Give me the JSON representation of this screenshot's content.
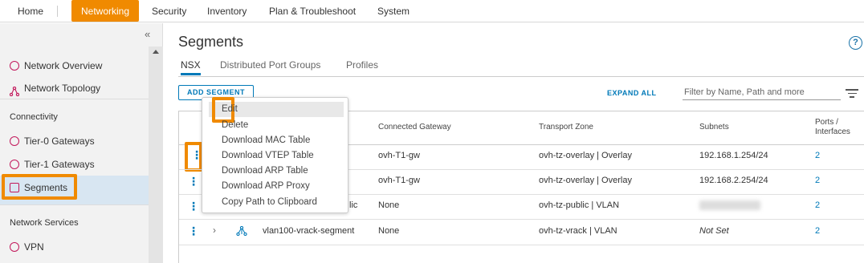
{
  "topnav": {
    "items": [
      "Home",
      "Networking",
      "Security",
      "Inventory",
      "Plan & Troubleshoot",
      "System"
    ],
    "active": "Networking"
  },
  "sidebar": {
    "items": [
      {
        "label": "Network Overview"
      },
      {
        "label": "Network Topology"
      }
    ],
    "connectivity_heading": "Connectivity",
    "connectivity": [
      {
        "label": "Tier-0 Gateways"
      },
      {
        "label": "Tier-1 Gateways"
      },
      {
        "label": "Segments"
      }
    ],
    "network_services_heading": "Network Services",
    "services": [
      {
        "label": "VPN"
      }
    ],
    "collapse_glyph": "«"
  },
  "main": {
    "title": "Segments",
    "help": "?",
    "tabs": [
      "NSX",
      "Distributed Port Groups",
      "Profiles"
    ],
    "add_button": "ADD SEGMENT",
    "expand_all": "EXPAND ALL",
    "filter_placeholder": "Filter by Name, Path and more"
  },
  "table": {
    "headers": {
      "connected_gateway": "Connected Gateway",
      "transport_zone": "Transport Zone",
      "subnets": "Subnets",
      "ports": "Ports / Interfaces"
    },
    "rows": [
      {
        "name": "",
        "gateway": "ovh-T1-gw",
        "zone": "ovh-tz-overlay | Overlay",
        "subnet": "192.168.1.254/24",
        "ports": "2"
      },
      {
        "name": "",
        "gateway": "ovh-T1-gw",
        "zone": "ovh-tz-overlay | Overlay",
        "subnet": "192.168.2.254/24",
        "ports": "2"
      },
      {
        "name": "lic",
        "gateway": "None",
        "zone": "ovh-tz-public | VLAN",
        "subnet": "",
        "ports": "2"
      },
      {
        "name": "vlan100-vrack-segment",
        "gateway": "None",
        "zone": "ovh-tz-vrack | VLAN",
        "subnet": "Not Set",
        "ports": "2"
      }
    ]
  },
  "context_menu": {
    "items": [
      "Edit",
      "Delete",
      "Download MAC Table",
      "Download VTEP Table",
      "Download ARP Table",
      "Download ARP Proxy",
      "Copy Path to Clipboard"
    ]
  },
  "colors": {
    "highlight": "#f08a00",
    "link": "#0079b8",
    "selected_bg": "#d8e6f2"
  }
}
